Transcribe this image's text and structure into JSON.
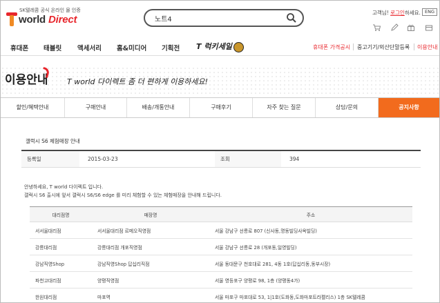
{
  "header": {
    "logo_sub": "SK텔레콤 공식 온라인 몰 인증",
    "logo_word_1": "world",
    "logo_word_2": "Direct",
    "search_value": "노트4",
    "user_greeting_prefix": "고객님!",
    "login_link": "로그인",
    "user_greeting_suffix": "하세요.",
    "lang_label": "ENG",
    "util_icons": [
      "cart-icon",
      "pencil-icon",
      "gift-icon",
      "box-icon"
    ]
  },
  "nav": {
    "items": [
      "휴대폰",
      "태블릿",
      "액세서리",
      "홈&미디어",
      "기획전"
    ],
    "tsale_label": "T 럭키세일",
    "right_items": [
      "휴대폰 가격공시",
      "중고기기/외산단말등록",
      "이용안내"
    ]
  },
  "banner": {
    "title": "이용안내",
    "subtitle": "T world 다이렉트 좀 더 편하게 이용하세요!"
  },
  "subtabs": [
    "할인/혜택안내",
    "구매안내",
    "배송/개통안내",
    "구매후기",
    "자주 찾는 질문",
    "상담/문의",
    "공지사항"
  ],
  "post": {
    "title": "갤럭시 S6 체험매장 안내",
    "date_label": "등록일",
    "date_value": "2015-03-23",
    "views_label": "조회",
    "views_value": "394",
    "body_line_1": "안녕하세요, T world 다이렉트 입니다.",
    "body_line_2": "갤럭시 S6 출시에 앞서 갤럭시 S6/S6 edge 를 미리 체험할 수 있는 체험매장을 안내해 드립니다."
  },
  "table": {
    "headers": [
      "대리점명",
      "매장명",
      "주소"
    ],
    "rows": [
      [
        "서서울대리점",
        "서서울대리점 르메오직영점",
        "서울 강남구 선릉로 807 (신사동,명동빌딩사옥빌딩)"
      ],
      [
        "강릉대리점",
        "강릉대리점 개포직영점",
        "서울 강남구 선릉로 28 (개포동,일영빌딩)"
      ],
      [
        "강남직영Shop",
        "강남직영Shop 답십리직점",
        "서울 동대문구 천호대로 281, 4동 1호(답십리동,동부시장)"
      ],
      [
        "파천고대리점",
        "양평직영점",
        "서울 영등포구 양평로 98, 1층 (양평동4가)"
      ],
      [
        "한원대리점",
        "마포역",
        "서울 마포구 마포대로 53, 1|1호(도화동,도화마포트라펠리스) 1층 SK텔레콤"
      ]
    ]
  },
  "colors": {
    "accent": "#f26b1d",
    "brand_red": "#e8262c"
  }
}
